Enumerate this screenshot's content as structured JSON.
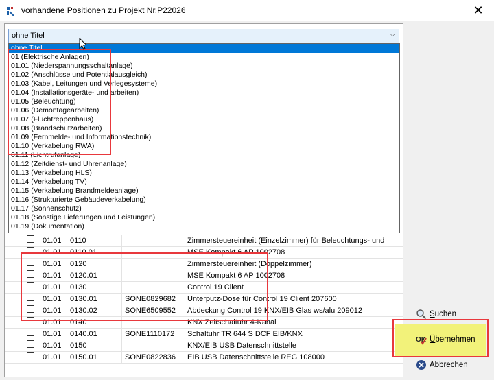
{
  "window": {
    "title": "vorhandene Positionen zu Projekt Nr.P22026",
    "close_glyph": "✕"
  },
  "combo": {
    "value": "ohne Titel",
    "arrow": "⌵"
  },
  "dropdown_items": [
    "ohne Titel",
    "01  (Elektrische Anlagen)",
    "01.01  (Niederspannungsschaltanlage)",
    "01.02  (Anschlüsse und Potentialausgleich)",
    "01.03  (Kabel, Leitungen und Verlegesysteme)",
    "01.04  (Installationsgeräte- und arbeiten)",
    "01.05  (Beleuchtung)",
    "01.06  (Demontagearbeiten)",
    "01.07  (Fluchtreppenhaus)",
    "01.08  (Brandschutzarbeiten)",
    "01.09  (Fernmelde- und Informationstechnik)",
    "01.10  (Verkabelung RWA)",
    "01.11  (Lichtrufanlage)",
    "01.12  (Zeitdienst- und Uhrenanlage)",
    "01.13  (Verkabelung HLS)",
    "01.14  (Verkabelung TV)",
    "01.15  (Verkabelung Brandmeldeanlage)",
    "01.16  (Strukturierte Gebäudeverkabelung)",
    "01.17  (Sonnenschutz)",
    "01.18  (Sonstige Lieferungen und Leistungen)",
    "01.19  (Dokumentation)"
  ],
  "rows": [
    {
      "group": "01.01",
      "pos": "0110",
      "art": "",
      "text": "Zimmersteuereinheit (Einzelzimmer) für Beleuchtungs- und"
    },
    {
      "group": "01.01",
      "pos": "0110.01",
      "art": "",
      "text": "MSE Kompakt 6 AP  1002708"
    },
    {
      "group": "01.01",
      "pos": "0120",
      "art": "",
      "text": "Zimmersteuereinheit (Doppelzimmer)"
    },
    {
      "group": "01.01",
      "pos": "0120.01",
      "art": "",
      "text": "MSE Kompakt 6 AP  1002708"
    },
    {
      "group": "01.01",
      "pos": "0130",
      "art": "",
      "text": "Control 19 Client"
    },
    {
      "group": "01.01",
      "pos": "0130.01",
      "art": "SONE0829682",
      "text": "Unterputz-Dose für Control 19 Client 207600"
    },
    {
      "group": "01.01",
      "pos": "0130.02",
      "art": "SONE6509552",
      "text": "Abdeckung Control 19 KNX/EIB Glas ws/alu 209012"
    },
    {
      "group": "01.01",
      "pos": "0140",
      "art": "",
      "text": "KNX Zeitschaltuhr 4-Kanal"
    },
    {
      "group": "01.01",
      "pos": "0140.01",
      "art": "SONE1110172",
      "text": "Schaltuhr  TR 644 S DCF EIB/KNX"
    },
    {
      "group": "01.01",
      "pos": "0150",
      "art": "",
      "text": "KNX/EIB USB Datenschnittstelle"
    },
    {
      "group": "01.01",
      "pos": "0150.01",
      "art": "SONE0822836",
      "text": "EIB USB Datenschnittstelle REG 108000"
    }
  ],
  "buttons": {
    "search": "Suchen",
    "apply": "Übernehmen",
    "cancel": "Abbrechen"
  },
  "colors": {
    "selection": "#0078d7",
    "annotation_red": "#e8383d",
    "highlight_yellow": "#f2f27a"
  }
}
